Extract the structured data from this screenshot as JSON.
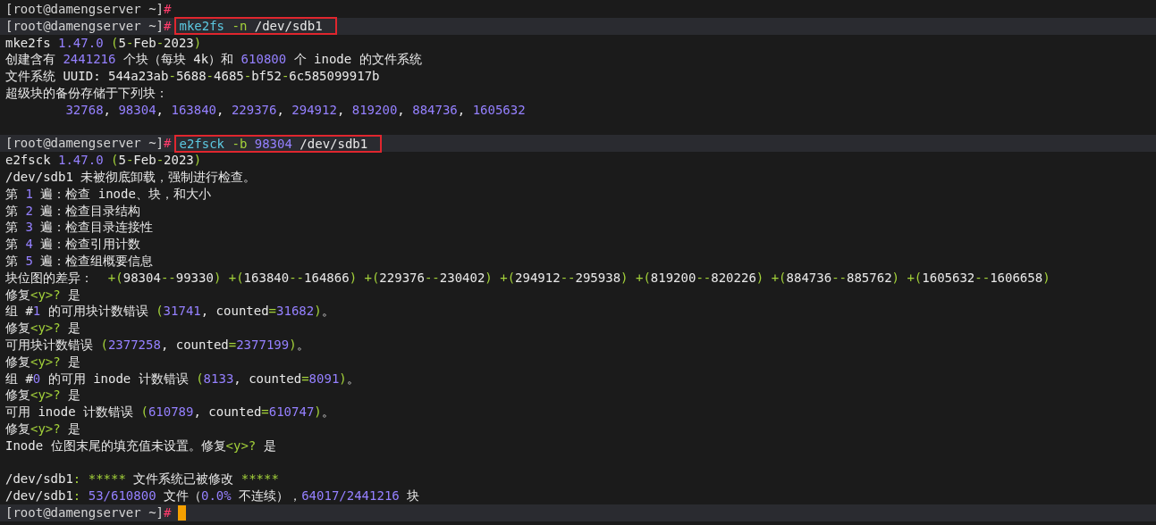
{
  "lines": [
    {
      "kind": "prompt",
      "highlighted": false,
      "prompt": "[root@damengserver ~]",
      "symbol": "#",
      "cursor": false
    },
    {
      "kind": "prompt",
      "highlighted": true,
      "prompt": "[root@damengserver ~]",
      "symbol": "#",
      "cursor": false,
      "command": {
        "boxed": true,
        "segments": [
          {
            "text": "mke2fs ",
            "kind": "program"
          },
          {
            "text": "-n",
            "kind": "symbol"
          },
          {
            "text": " /dev/sdb1",
            "kind": "plain"
          }
        ]
      }
    },
    {
      "kind": "output",
      "highlighted": false,
      "segments": [
        {
          "text": "mke2fs ",
          "kind": "plain"
        },
        {
          "text": "1.47.0",
          "kind": "number"
        },
        {
          "text": " (",
          "kind": "symbol"
        },
        {
          "text": "5",
          "kind": "plain"
        },
        {
          "text": "-",
          "kind": "symbol"
        },
        {
          "text": "Feb",
          "kind": "plain"
        },
        {
          "text": "-",
          "kind": "symbol"
        },
        {
          "text": "2023",
          "kind": "plain"
        },
        {
          "text": ")",
          "kind": "symbol"
        }
      ]
    },
    {
      "kind": "output",
      "highlighted": false,
      "segments": [
        {
          "text": "创建含有 ",
          "kind": "plain"
        },
        {
          "text": "2441216",
          "kind": "number"
        },
        {
          "text": " 个块（每块 4k）和 ",
          "kind": "plain"
        },
        {
          "text": "610800",
          "kind": "number"
        },
        {
          "text": " 个 inode 的文件系统",
          "kind": "plain"
        }
      ]
    },
    {
      "kind": "output",
      "highlighted": false,
      "segments": [
        {
          "text": "文件系统 UUID: 544a23ab",
          "kind": "plain"
        },
        {
          "text": "-",
          "kind": "symbol"
        },
        {
          "text": "5688",
          "kind": "plain"
        },
        {
          "text": "-",
          "kind": "symbol"
        },
        {
          "text": "4685",
          "kind": "plain"
        },
        {
          "text": "-",
          "kind": "symbol"
        },
        {
          "text": "bf52",
          "kind": "plain"
        },
        {
          "text": "-",
          "kind": "symbol"
        },
        {
          "text": "6c585099917b",
          "kind": "plain"
        }
      ]
    },
    {
      "kind": "output",
      "highlighted": false,
      "segments": [
        {
          "text": "超级块的备份存储于下列块：",
          "kind": "plain"
        }
      ]
    },
    {
      "kind": "output",
      "highlighted": false,
      "segments": [
        {
          "text": "        32768",
          "kind": "number"
        },
        {
          "text": ", ",
          "kind": "plain"
        },
        {
          "text": "98304",
          "kind": "number"
        },
        {
          "text": ", ",
          "kind": "plain"
        },
        {
          "text": "163840",
          "kind": "number"
        },
        {
          "text": ", ",
          "kind": "plain"
        },
        {
          "text": "229376",
          "kind": "number"
        },
        {
          "text": ", ",
          "kind": "plain"
        },
        {
          "text": "294912",
          "kind": "number"
        },
        {
          "text": ", ",
          "kind": "plain"
        },
        {
          "text": "819200",
          "kind": "number"
        },
        {
          "text": ", ",
          "kind": "plain"
        },
        {
          "text": "884736",
          "kind": "number"
        },
        {
          "text": ", ",
          "kind": "plain"
        },
        {
          "text": "1605632",
          "kind": "number"
        }
      ]
    },
    {
      "kind": "blank",
      "highlighted": false
    },
    {
      "kind": "prompt",
      "highlighted": true,
      "prompt": "[root@damengserver ~]",
      "symbol": "#",
      "cursor": false,
      "command": {
        "boxed": true,
        "segments": [
          {
            "text": "e2fsck ",
            "kind": "program"
          },
          {
            "text": "-b ",
            "kind": "symbol"
          },
          {
            "text": "98304",
            "kind": "number"
          },
          {
            "text": " /dev/sdb1",
            "kind": "plain"
          }
        ]
      }
    },
    {
      "kind": "output",
      "highlighted": false,
      "segments": [
        {
          "text": "e2fsck ",
          "kind": "plain"
        },
        {
          "text": "1.47.0",
          "kind": "number"
        },
        {
          "text": " (",
          "kind": "symbol"
        },
        {
          "text": "5",
          "kind": "plain"
        },
        {
          "text": "-",
          "kind": "symbol"
        },
        {
          "text": "Feb",
          "kind": "plain"
        },
        {
          "text": "-",
          "kind": "symbol"
        },
        {
          "text": "2023",
          "kind": "plain"
        },
        {
          "text": ")",
          "kind": "symbol"
        }
      ]
    },
    {
      "kind": "output",
      "highlighted": false,
      "segments": [
        {
          "text": "/dev/sdb1 未被彻底卸载，强制进行检查。",
          "kind": "plain"
        }
      ]
    },
    {
      "kind": "output",
      "highlighted": false,
      "segments": [
        {
          "text": "第 ",
          "kind": "plain"
        },
        {
          "text": "1",
          "kind": "number"
        },
        {
          "text": " 遍：检查 inode、块，和大小",
          "kind": "plain"
        }
      ]
    },
    {
      "kind": "output",
      "highlighted": false,
      "segments": [
        {
          "text": "第 ",
          "kind": "plain"
        },
        {
          "text": "2",
          "kind": "number"
        },
        {
          "text": " 遍：检查目录结构",
          "kind": "plain"
        }
      ]
    },
    {
      "kind": "output",
      "highlighted": false,
      "segments": [
        {
          "text": "第 ",
          "kind": "plain"
        },
        {
          "text": "3",
          "kind": "number"
        },
        {
          "text": " 遍：检查目录连接性",
          "kind": "plain"
        }
      ]
    },
    {
      "kind": "output",
      "highlighted": false,
      "segments": [
        {
          "text": "第 ",
          "kind": "plain"
        },
        {
          "text": "4",
          "kind": "number"
        },
        {
          "text": " 遍：检查引用计数",
          "kind": "plain"
        }
      ]
    },
    {
      "kind": "output",
      "highlighted": false,
      "segments": [
        {
          "text": "第 ",
          "kind": "plain"
        },
        {
          "text": "5",
          "kind": "number"
        },
        {
          "text": " 遍：检查组概要信息",
          "kind": "plain"
        }
      ]
    },
    {
      "kind": "output",
      "highlighted": false,
      "segments": [
        {
          "text": "块位图的差异：  ",
          "kind": "plain"
        },
        {
          "text": "+(",
          "kind": "symbol"
        },
        {
          "text": "98304",
          "kind": "plain"
        },
        {
          "text": "--",
          "kind": "symbol"
        },
        {
          "text": "99330",
          "kind": "plain"
        },
        {
          "text": ") +(",
          "kind": "symbol"
        },
        {
          "text": "163840",
          "kind": "plain"
        },
        {
          "text": "--",
          "kind": "symbol"
        },
        {
          "text": "164866",
          "kind": "plain"
        },
        {
          "text": ") +(",
          "kind": "symbol"
        },
        {
          "text": "229376",
          "kind": "plain"
        },
        {
          "text": "--",
          "kind": "symbol"
        },
        {
          "text": "230402",
          "kind": "plain"
        },
        {
          "text": ") +(",
          "kind": "symbol"
        },
        {
          "text": "294912",
          "kind": "plain"
        },
        {
          "text": "--",
          "kind": "symbol"
        },
        {
          "text": "295938",
          "kind": "plain"
        },
        {
          "text": ") +(",
          "kind": "symbol"
        },
        {
          "text": "819200",
          "kind": "plain"
        },
        {
          "text": "--",
          "kind": "symbol"
        },
        {
          "text": "820226",
          "kind": "plain"
        },
        {
          "text": ") +(",
          "kind": "symbol"
        },
        {
          "text": "884736",
          "kind": "plain"
        },
        {
          "text": "--",
          "kind": "symbol"
        },
        {
          "text": "885762",
          "kind": "plain"
        },
        {
          "text": ") +(",
          "kind": "symbol"
        },
        {
          "text": "1605632",
          "kind": "plain"
        },
        {
          "text": "--",
          "kind": "symbol"
        },
        {
          "text": "1606658",
          "kind": "plain"
        },
        {
          "text": ")",
          "kind": "symbol"
        }
      ]
    },
    {
      "kind": "output",
      "highlighted": false,
      "segments": [
        {
          "text": "修复",
          "kind": "plain"
        },
        {
          "text": "<y>?",
          "kind": "symbol"
        },
        {
          "text": " 是",
          "kind": "plain"
        }
      ]
    },
    {
      "kind": "output",
      "highlighted": false,
      "segments": [
        {
          "text": "组 #",
          "kind": "plain"
        },
        {
          "text": "1",
          "kind": "number"
        },
        {
          "text": " 的可用块计数错误 ",
          "kind": "plain"
        },
        {
          "text": "(",
          "kind": "symbol"
        },
        {
          "text": "31741",
          "kind": "number"
        },
        {
          "text": ", counted",
          "kind": "plain"
        },
        {
          "text": "=",
          "kind": "symbol"
        },
        {
          "text": "31682",
          "kind": "number"
        },
        {
          "text": ")",
          "kind": "symbol"
        },
        {
          "text": "。",
          "kind": "plain"
        }
      ]
    },
    {
      "kind": "output",
      "highlighted": false,
      "segments": [
        {
          "text": "修复",
          "kind": "plain"
        },
        {
          "text": "<y>?",
          "kind": "symbol"
        },
        {
          "text": " 是",
          "kind": "plain"
        }
      ]
    },
    {
      "kind": "output",
      "highlighted": false,
      "segments": [
        {
          "text": "可用块计数错误 ",
          "kind": "plain"
        },
        {
          "text": "(",
          "kind": "symbol"
        },
        {
          "text": "2377258",
          "kind": "number"
        },
        {
          "text": ", counted",
          "kind": "plain"
        },
        {
          "text": "=",
          "kind": "symbol"
        },
        {
          "text": "2377199",
          "kind": "number"
        },
        {
          "text": ")",
          "kind": "symbol"
        },
        {
          "text": "。",
          "kind": "plain"
        }
      ]
    },
    {
      "kind": "output",
      "highlighted": false,
      "segments": [
        {
          "text": "修复",
          "kind": "plain"
        },
        {
          "text": "<y>?",
          "kind": "symbol"
        },
        {
          "text": " 是",
          "kind": "plain"
        }
      ]
    },
    {
      "kind": "output",
      "highlighted": false,
      "segments": [
        {
          "text": "组 #",
          "kind": "plain"
        },
        {
          "text": "0",
          "kind": "number"
        },
        {
          "text": " 的可用 inode 计数错误 ",
          "kind": "plain"
        },
        {
          "text": "(",
          "kind": "symbol"
        },
        {
          "text": "8133",
          "kind": "number"
        },
        {
          "text": ", counted",
          "kind": "plain"
        },
        {
          "text": "=",
          "kind": "symbol"
        },
        {
          "text": "8091",
          "kind": "number"
        },
        {
          "text": ")",
          "kind": "symbol"
        },
        {
          "text": "。",
          "kind": "plain"
        }
      ]
    },
    {
      "kind": "output",
      "highlighted": false,
      "segments": [
        {
          "text": "修复",
          "kind": "plain"
        },
        {
          "text": "<y>?",
          "kind": "symbol"
        },
        {
          "text": " 是",
          "kind": "plain"
        }
      ]
    },
    {
      "kind": "output",
      "highlighted": false,
      "segments": [
        {
          "text": "可用 inode 计数错误 ",
          "kind": "plain"
        },
        {
          "text": "(",
          "kind": "symbol"
        },
        {
          "text": "610789",
          "kind": "number"
        },
        {
          "text": ", counted",
          "kind": "plain"
        },
        {
          "text": "=",
          "kind": "symbol"
        },
        {
          "text": "610747",
          "kind": "number"
        },
        {
          "text": ")",
          "kind": "symbol"
        },
        {
          "text": "。",
          "kind": "plain"
        }
      ]
    },
    {
      "kind": "output",
      "highlighted": false,
      "segments": [
        {
          "text": "修复",
          "kind": "plain"
        },
        {
          "text": "<y>?",
          "kind": "symbol"
        },
        {
          "text": " 是",
          "kind": "plain"
        }
      ]
    },
    {
      "kind": "output",
      "highlighted": false,
      "segments": [
        {
          "text": "Inode 位图末尾的填充值未设置。修复",
          "kind": "plain"
        },
        {
          "text": "<y>?",
          "kind": "symbol"
        },
        {
          "text": " 是",
          "kind": "plain"
        }
      ]
    },
    {
      "kind": "blank",
      "highlighted": false
    },
    {
      "kind": "output",
      "highlighted": false,
      "segments": [
        {
          "text": "/dev/sdb1",
          "kind": "plain"
        },
        {
          "text": ": *****",
          "kind": "symbol"
        },
        {
          "text": " 文件系统已被修改 ",
          "kind": "plain"
        },
        {
          "text": "*****",
          "kind": "symbol"
        }
      ]
    },
    {
      "kind": "output",
      "highlighted": false,
      "segments": [
        {
          "text": "/dev/sdb1",
          "kind": "plain"
        },
        {
          "text": ": ",
          "kind": "symbol"
        },
        {
          "text": "53/610800",
          "kind": "number"
        },
        {
          "text": " 文件（",
          "kind": "plain"
        },
        {
          "text": "0.0%",
          "kind": "number"
        },
        {
          "text": " 不连续），",
          "kind": "plain"
        },
        {
          "text": "64017/2441216",
          "kind": "number"
        },
        {
          "text": " 块",
          "kind": "plain"
        }
      ]
    },
    {
      "kind": "prompt",
      "highlighted": true,
      "prompt": "[root@damengserver ~]",
      "symbol": "#",
      "cursor": true
    }
  ]
}
